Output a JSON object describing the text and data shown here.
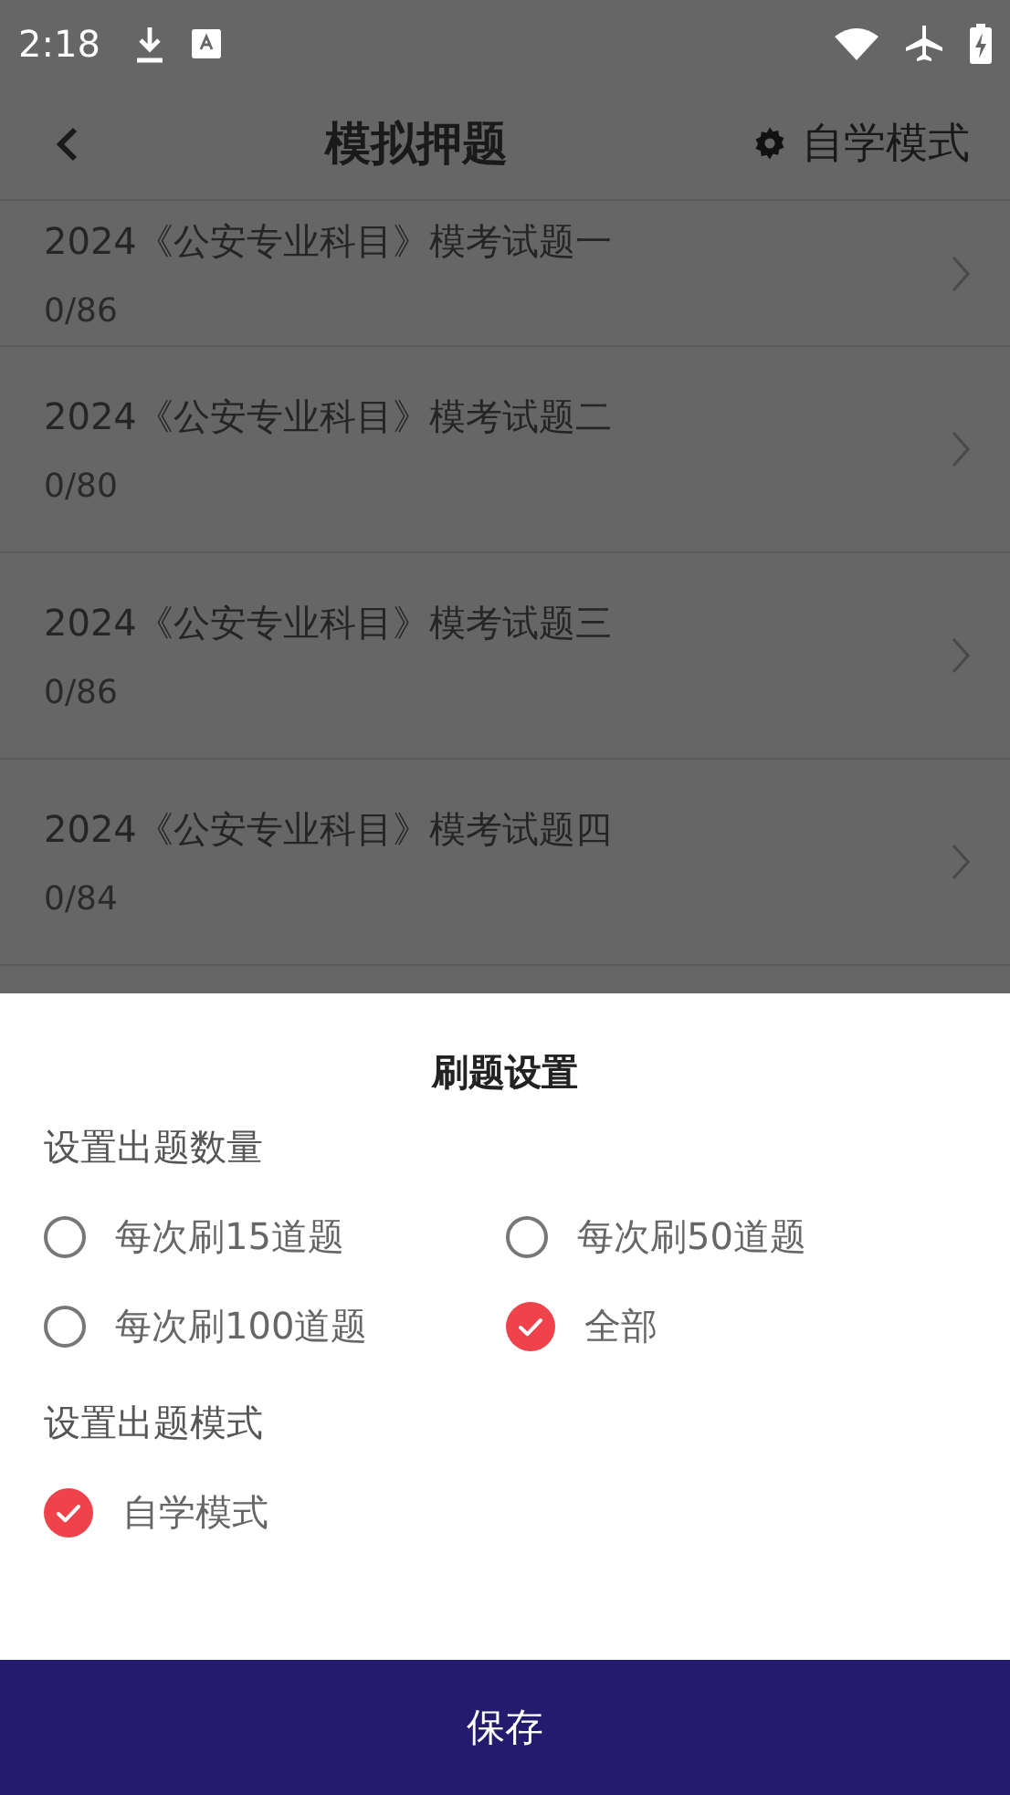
{
  "status_bar": {
    "time": "2:18"
  },
  "header": {
    "title": "模拟押题",
    "action": "自学模式"
  },
  "list": [
    {
      "title": "2024《公安专业科目》模考试题一",
      "count": "0/86"
    },
    {
      "title": "2024《公安专业科目》模考试题二",
      "count": "0/80"
    },
    {
      "title": "2024《公安专业科目》模考试题三",
      "count": "0/86"
    },
    {
      "title": "2024《公安专业科目》模考试题四",
      "count": "0/84"
    }
  ],
  "sheet": {
    "title": "刷题设置",
    "sections": [
      {
        "label": "设置出题数量",
        "options": [
          {
            "label": "每次刷15道题",
            "selected": false
          },
          {
            "label": "每次刷50道题",
            "selected": false
          },
          {
            "label": "每次刷100道题",
            "selected": false
          },
          {
            "label": "全部",
            "selected": true
          }
        ]
      },
      {
        "label": "设置出题模式",
        "options": [
          {
            "label": "自学模式",
            "selected": true
          }
        ]
      }
    ]
  },
  "save_button": "保存"
}
